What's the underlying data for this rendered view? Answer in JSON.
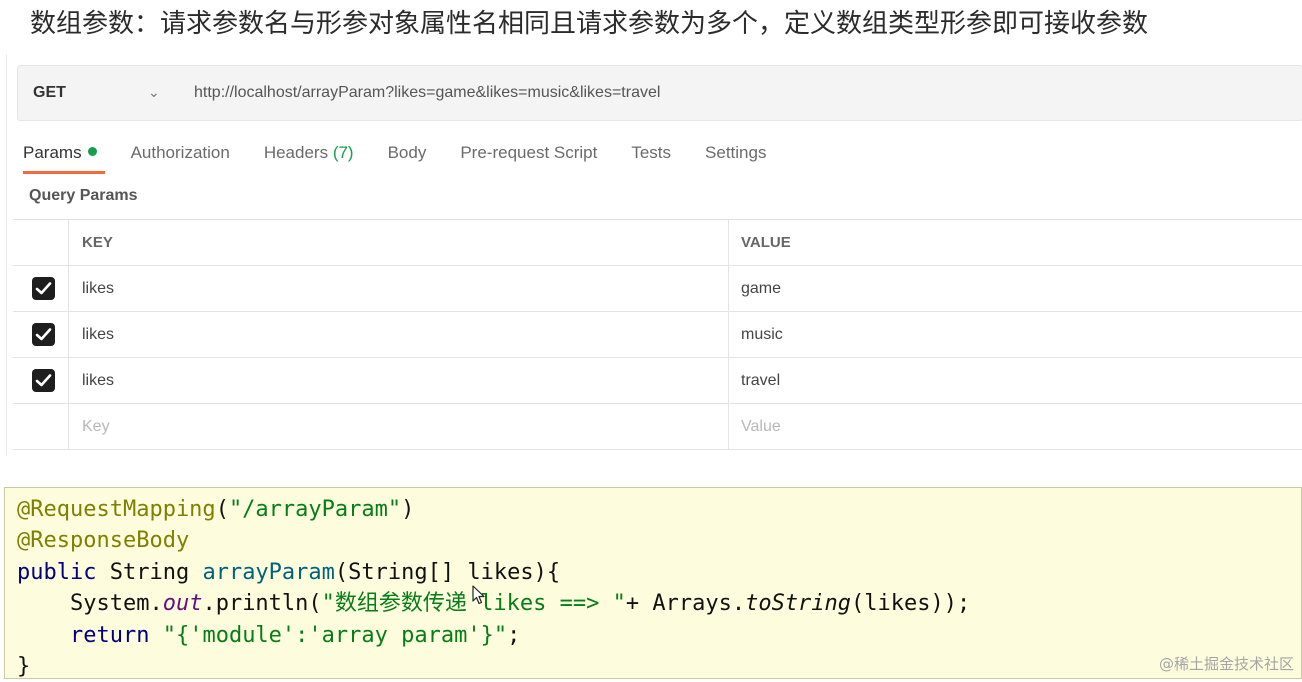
{
  "heading": "数组参数：请求参数名与形参对象属性名相同且请求参数为多个，定义数组类型形参即可接收参数",
  "request": {
    "method": "GET",
    "url": "http://localhost/arrayParam?likes=game&likes=music&likes=travel"
  },
  "tabs": [
    {
      "label": "Params",
      "active": true
    },
    {
      "label": "Authorization"
    },
    {
      "label": "Headers",
      "count": "(7)"
    },
    {
      "label": "Body"
    },
    {
      "label": "Pre-request Script"
    },
    {
      "label": "Tests"
    },
    {
      "label": "Settings"
    }
  ],
  "query_params": {
    "title": "Query Params",
    "columns": {
      "key": "KEY",
      "value": "VALUE"
    },
    "rows": [
      {
        "key": "likes",
        "value": "game",
        "checked": true
      },
      {
        "key": "likes",
        "value": "music",
        "checked": true
      },
      {
        "key": "likes",
        "value": "travel",
        "checked": true
      }
    ],
    "placeholder": {
      "key": "Key",
      "value": "Value"
    }
  },
  "code": {
    "l1_anno": "@RequestMapping",
    "l1_open": "(",
    "l1_str": "\"/arrayParam\"",
    "l1_close": ")",
    "l2_anno": "@ResponseBody",
    "l3_kw": "public",
    "l3_rest1": " String ",
    "l3_fn": "arrayParam",
    "l3_rest2": "(String[] likes){",
    "l4_indent": "    System.",
    "l4_field": "out",
    "l4_mid": ".println(",
    "l4_str": "\"数组参数传递 likes ==> \"",
    "l4_rest": "+ Arrays.",
    "l4_method": "toString",
    "l4_end": "(likes));",
    "l5_indent": "    ",
    "l5_kw": "return",
    "l5_sp": " ",
    "l5_str": "\"{'module':'array param'}\"",
    "l5_end": ";",
    "l6": "}"
  },
  "watermark": "@稀土掘金技术社区",
  "colors": {
    "active_tab_underline": "#f26b3a",
    "status_dot": "#12a04b",
    "code_background": "#fdfdde"
  }
}
